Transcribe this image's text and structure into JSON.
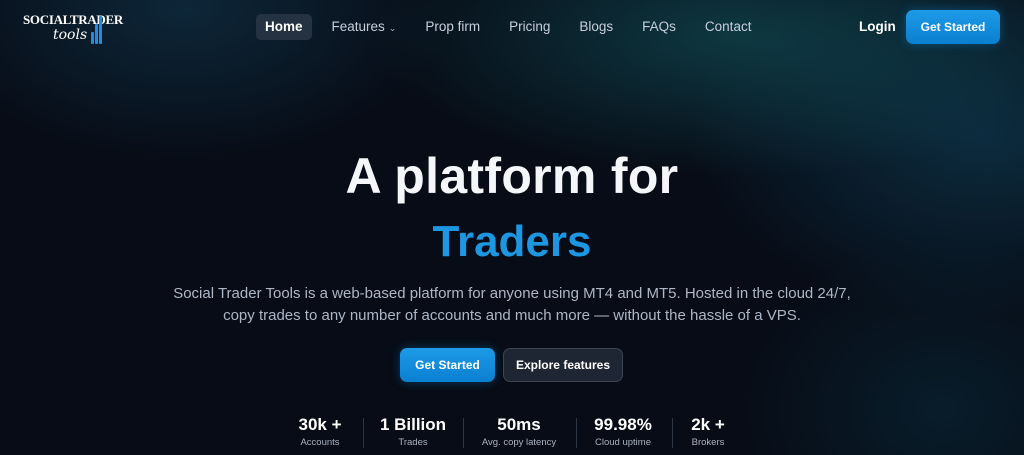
{
  "logo": {
    "top_text": "SOCIALTRADER",
    "bottom_text": "tools",
    "bar_color": "#1e8fe0"
  },
  "nav": {
    "links": [
      {
        "label": "Home",
        "active": true
      },
      {
        "label": "Features",
        "dropdown": true
      },
      {
        "label": "Prop firm"
      },
      {
        "label": "Pricing"
      },
      {
        "label": "Blogs"
      },
      {
        "label": "FAQs"
      },
      {
        "label": "Contact"
      }
    ],
    "login_label": "Login",
    "cta_label": "Get Started"
  },
  "hero": {
    "title_line1": "A platform for",
    "title_line2": "Traders",
    "description_line1": "Social Trader Tools is a web-based platform for anyone using MT4 and MT5. Hosted in the cloud 24/7,",
    "description_line2": "copy trades to any number of accounts and much more — without the hassle of a VPS.",
    "primary_cta": "Get Started",
    "secondary_cta": "Explore features"
  },
  "stats": [
    {
      "value": "30k +",
      "label": "Accounts"
    },
    {
      "value": "1 Billion",
      "label": "Trades"
    },
    {
      "value": "50ms",
      "label": "Avg. copy latency"
    },
    {
      "value": "99.98%",
      "label": "Cloud uptime"
    },
    {
      "value": "2k +",
      "label": "Brokers"
    }
  ],
  "colors": {
    "accent": "#1e97e2",
    "background": "#070c16"
  }
}
